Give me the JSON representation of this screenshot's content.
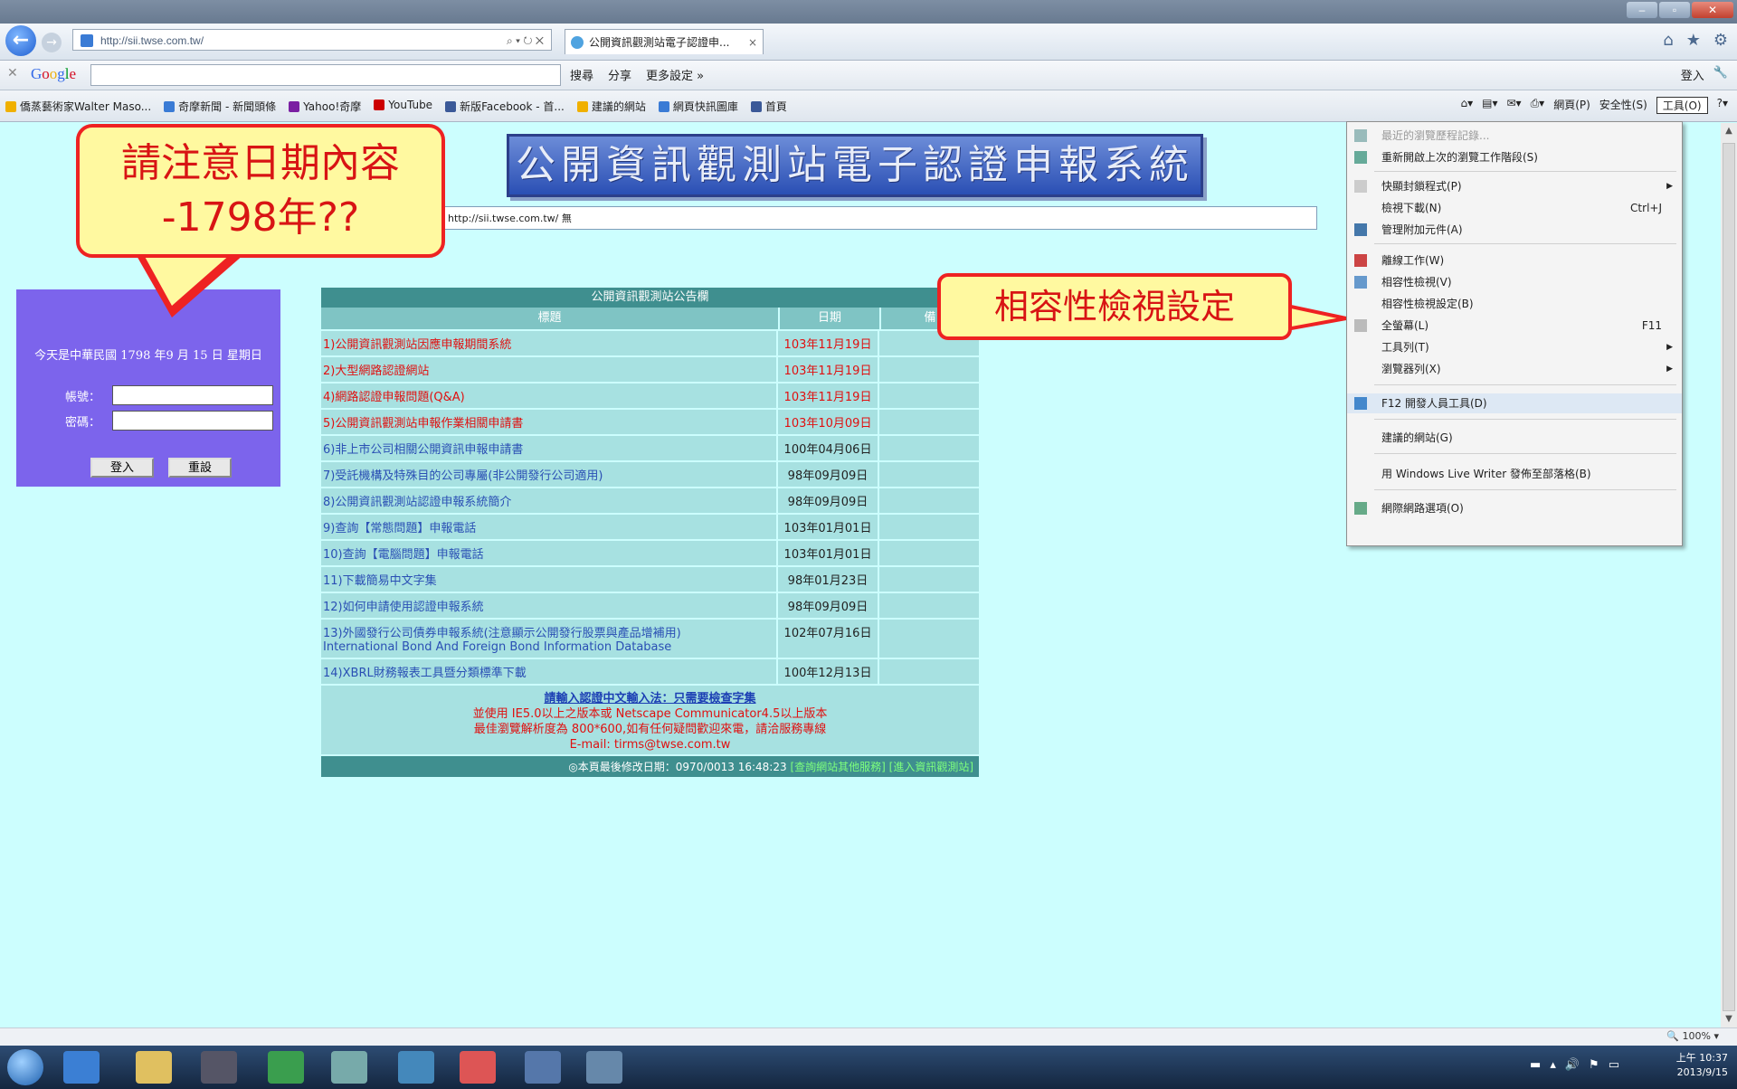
{
  "browser": {
    "address_url": "http://sii.twse.com.tw/",
    "tab_title": "公開資訊觀測站電子認證申...",
    "search_placeholder": "",
    "google_label": "Google",
    "google_tools": [
      "搜尋",
      "分享",
      "更多設定 »"
    ],
    "google_right": [
      "登入"
    ],
    "favorites": [
      "僑蒸藝術家Walter Maso...",
      "奇摩新聞 - 新聞頭條",
      "Yahoo!奇摩",
      "YouTube",
      "新版Facebook - 首...",
      "建議的網站",
      "網頁快訊圖庫",
      "首頁"
    ],
    "command_bar": [
      "網頁(P)",
      "安全性(S)",
      "工具(O)"
    ]
  },
  "page": {
    "banner_title": "公開資訊觀測站電子認證申報系統",
    "url_field": "http://sii.twse.com.tw/ 無",
    "login": {
      "date_line": "今天是中華民國 1798 年9 月 15 日 星期日",
      "account_label": "帳號：",
      "password_label": "密碼：",
      "login_button": "登入",
      "reset_button": "重設"
    },
    "bulletin": {
      "header": "公開資訊觀測站公告欄",
      "col_title": "標題",
      "col_date": "日期",
      "col_extra": "備",
      "rows": [
        {
          "title": "1)公開資訊觀測站因應申報期間系統",
          "date": "103年11月19日",
          "style": "red"
        },
        {
          "title": "2)大型網路認證網站",
          "date": "103年11月19日",
          "style": "red"
        },
        {
          "title": "4)網路認證申報問題(Q&A)",
          "date": "103年11月19日",
          "style": "red"
        },
        {
          "title": "5)公開資訊觀測站申報作業相關申請書",
          "date": "103年10月09日",
          "style": "red"
        },
        {
          "title": "6)非上市公司相關公開資訊申報申請書",
          "date": "100年04月06日",
          "style": "blue"
        },
        {
          "title": "7)受託機構及特殊目的公司專屬(非公開發行公司適用)",
          "date": "98年09月09日",
          "style": "blue"
        },
        {
          "title": "8)公開資訊觀測站認證申報系統簡介",
          "date": "98年09月09日",
          "style": "blue"
        },
        {
          "title": "9)查詢【常態問題】申報電話",
          "date": "103年01月01日",
          "style": "blue"
        },
        {
          "title": "10)查詢【電腦問題】申報電話",
          "date": "103年01月01日",
          "style": "blue"
        },
        {
          "title": "11)下載簡易中文字集",
          "date": "98年01月23日",
          "style": "blue"
        },
        {
          "title": "12)如何申請使用認證申報系統",
          "date": "98年09月09日",
          "style": "blue"
        },
        {
          "title": "13)外國發行公司債券申報系統(注意顯示公開發行股票與產品增補用)",
          "title2": "International Bond And Foreign Bond Information Database",
          "date": "102年07月16日",
          "style": "blue"
        },
        {
          "title": "14)XBRL財務報表工具暨分類標準下載",
          "date": "100年12月13日",
          "style": "blue"
        }
      ],
      "footer_link": "請輸入認證中文輸入法：只需要檢查字集",
      "footer_line2": "並使用 IE5.0以上之版本或 Netscape Communicator4.5以上版本",
      "footer_line3": "最佳瀏覽解析度為 800*600,如有任何疑問歡迎來電，請洽服務專線",
      "footer_line4": "E-mail: tirms@twse.com.tw",
      "update_text": "◎本頁最後修改日期：0970/0013 16:48:23",
      "update_links": "[查詢網站其他服務] [進入資訊觀測站]"
    }
  },
  "annotations": {
    "callout_date_line1": "請注意日期內容",
    "callout_date_line2": "-1798年??",
    "callout_compat": "相容性檢視設定"
  },
  "tools_menu": {
    "items": [
      {
        "label": "最近的瀏覽歷程記錄...",
        "shortcut": "",
        "disabled": true
      },
      {
        "label": "重新開啟上次的瀏覽工作階段(S)",
        "shortcut": ""
      },
      {
        "label": "快顯封鎖程式(P)",
        "shortcut": "",
        "arrow": true
      },
      {
        "label": "檢視下載(N)",
        "shortcut": "Ctrl+J"
      },
      {
        "label": "管理附加元件(A)",
        "shortcut": ""
      },
      {
        "label": "離線工作(W)",
        "shortcut": ""
      },
      {
        "label": "相容性檢視(V)",
        "shortcut": ""
      },
      {
        "label": "相容性檢視設定(B)",
        "shortcut": ""
      },
      {
        "label": "全螢幕(L)",
        "shortcut": "F11"
      },
      {
        "label": "工具列(T)",
        "shortcut": "",
        "arrow": true
      },
      {
        "label": "瀏覽器列(X)",
        "shortcut": "",
        "arrow": true
      },
      {
        "label": "F12 開發人員工具(D)",
        "shortcut": ""
      },
      {
        "label": "建議的網站(G)",
        "shortcut": ""
      },
      {
        "label": "用 Windows Live Writer 發佈至部落格(B)",
        "shortcut": ""
      },
      {
        "label": "網際網路選項(O)",
        "shortcut": ""
      }
    ]
  },
  "status": {
    "zoom": "100%"
  },
  "taskbar": {
    "time": "上午 10:37",
    "date": "2013/9/15"
  }
}
